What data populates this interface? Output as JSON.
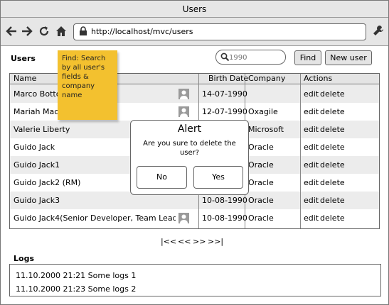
{
  "window": {
    "title": "Users"
  },
  "browser": {
    "url": "http://localhost/mvc/users",
    "icons": [
      "back-arrow-icon",
      "forward-arrow-icon",
      "reload-icon",
      "home-icon",
      "lock-icon",
      "wrench-icon"
    ]
  },
  "users_section": {
    "heading": "Users",
    "search_placeholder": "1990",
    "find_label": "Find",
    "new_user_label": "New user"
  },
  "sticky_note": {
    "text": "Find: Search by all user's fields & company name",
    "color": "#f3c12f"
  },
  "table": {
    "columns": [
      "Name",
      "Birth Date",
      "Company",
      "Actions"
    ],
    "rows": [
      {
        "name": "Marco Bottoni",
        "birth": "14-07-1990",
        "company": "",
        "action_edit": "edit",
        "action_delete": "delete",
        "icon": true
      },
      {
        "name": "Mariah Maclachlan",
        "birth": "12-07-1990",
        "company": "Oxagile",
        "action_edit": "edit",
        "action_delete": "delete",
        "icon": true
      },
      {
        "name": "Valerie Liberty",
        "birth": "",
        "company": "Microsoft",
        "action_edit": "edit",
        "action_delete": "delete",
        "icon": false
      },
      {
        "name": "Guido Jack",
        "birth": "",
        "company": "Oracle",
        "action_edit": "edit",
        "action_delete": "delete",
        "icon": false
      },
      {
        "name": "Guido Jack1",
        "birth": "",
        "company": "Oracle",
        "action_edit": "edit",
        "action_delete": "delete",
        "icon": false
      },
      {
        "name": "Guido Jack2 (RM)",
        "birth": "",
        "company": "Oracle",
        "action_edit": "edit",
        "action_delete": "delete",
        "icon": false
      },
      {
        "name": "Guido Jack3",
        "birth": "10-08-1990",
        "company": "Oracle",
        "action_edit": "edit",
        "action_delete": "delete",
        "icon": false
      },
      {
        "name": "Guido Jack4(Senior Developer, Team Lead)",
        "birth": "10-08-1990",
        "company": "Oracle",
        "action_edit": "edit",
        "action_delete": "delete",
        "icon": true
      }
    ]
  },
  "pagination": {
    "first": "|<<",
    "prev": "<<",
    "next": ">>",
    "last": ">>|"
  },
  "alert": {
    "title": "Alert",
    "message": "Are you sure to delete the user?",
    "no_label": "No",
    "yes_label": "Yes"
  },
  "logs": {
    "heading": "Logs",
    "lines": [
      "11.10.2000 21:21 Some logs 1",
      "11.10.2000 21:23 Some logs 2"
    ]
  }
}
